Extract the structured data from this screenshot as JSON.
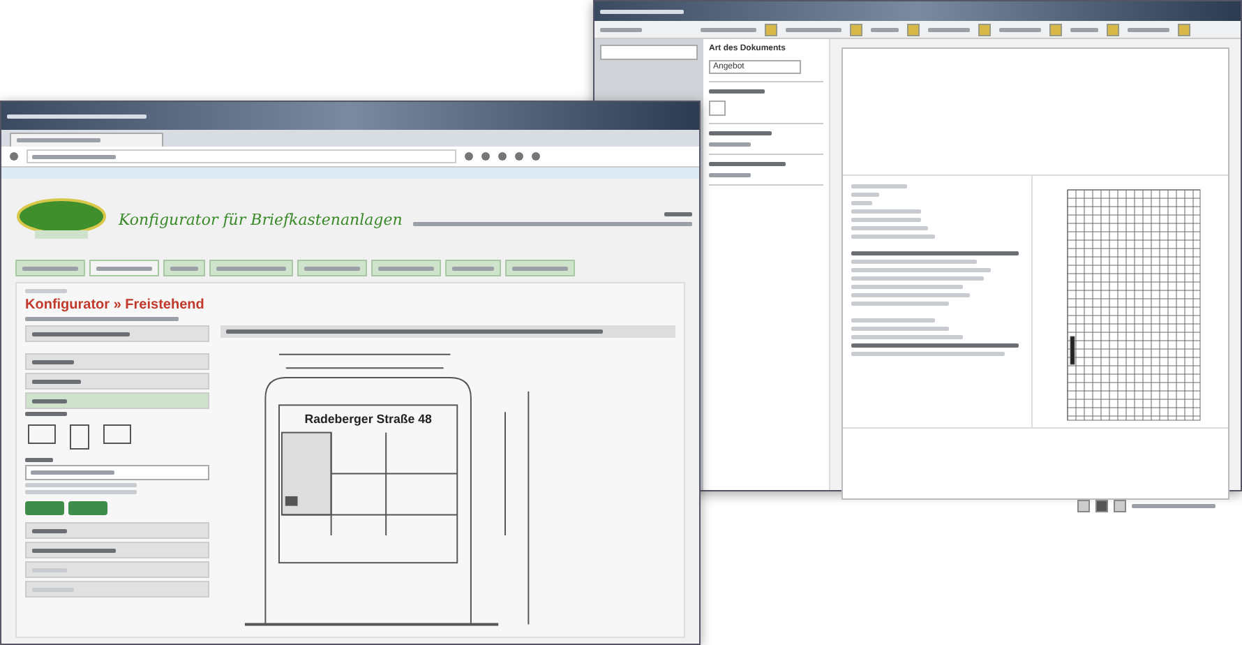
{
  "back_window": {
    "fields": [
      {
        "label": "Art des Dokuments",
        "value": "Angebot"
      }
    ]
  },
  "front_window": {
    "nav_tabs": [
      {
        "selected": false
      },
      {
        "selected": true
      },
      {
        "selected": false
      },
      {
        "selected": false
      },
      {
        "selected": false
      },
      {
        "selected": false
      },
      {
        "selected": false
      },
      {
        "selected": false
      }
    ],
    "logo_text": "Konfigurator für Briefkastenanlagen",
    "heading": "Konfigurator » Freistehend",
    "nameplate": "Radeberger Straße 48"
  }
}
